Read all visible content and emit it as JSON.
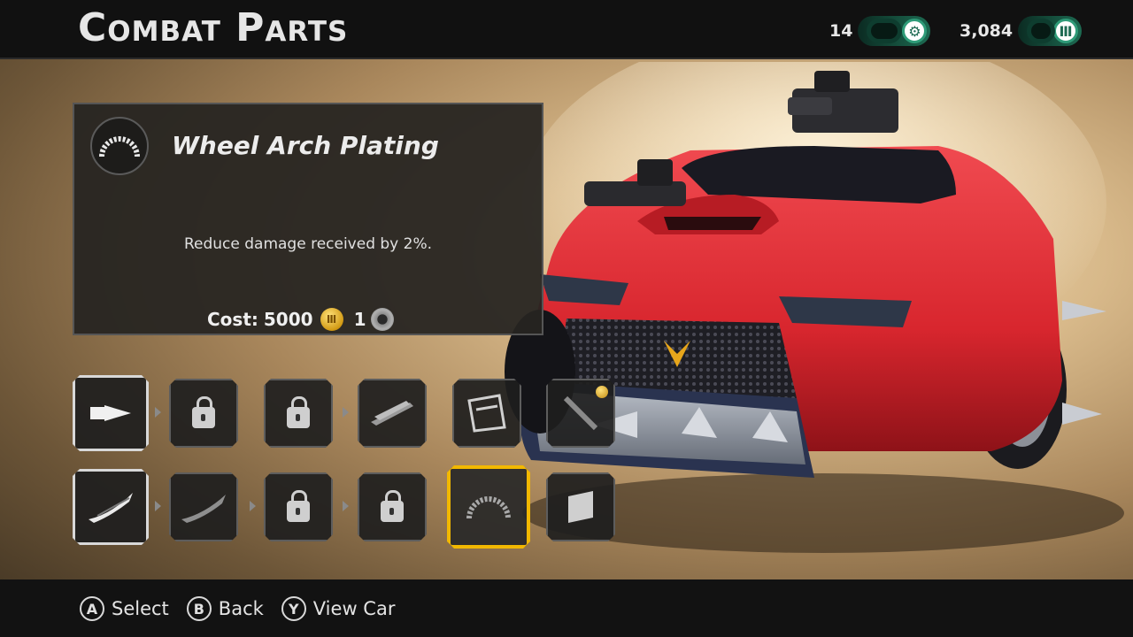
{
  "header": {
    "title": "Combat Parts",
    "gears_count": "14",
    "coins_count": "3,084"
  },
  "selected_part": {
    "name": "Wheel Arch Plating",
    "description": "Reduce damage received by 2%.",
    "cost_label": "Cost:",
    "cost_coins": "5000",
    "cost_gears": "1"
  },
  "parts": {
    "row1": [
      {
        "name": "drill-ram",
        "state": "owned"
      },
      {
        "name": "locked",
        "state": "locked"
      },
      {
        "name": "locked",
        "state": "locked"
      },
      {
        "name": "blade-plates",
        "state": "available"
      },
      {
        "name": "cage-frame",
        "state": "available"
      },
      {
        "name": "cannon-part",
        "state": "available"
      }
    ],
    "row2": [
      {
        "name": "wing-blades",
        "state": "owned"
      },
      {
        "name": "spiked-wing",
        "state": "available"
      },
      {
        "name": "locked",
        "state": "locked"
      },
      {
        "name": "locked",
        "state": "locked"
      },
      {
        "name": "wheel-arch-plating",
        "state": "selected"
      },
      {
        "name": "armor-plate",
        "state": "available"
      }
    ]
  },
  "footer": {
    "a_key": "A",
    "a_label": "Select",
    "b_key": "B",
    "b_label": "Back",
    "y_key": "Y",
    "y_label": "View Car"
  },
  "colors": {
    "selection": "#f2b800",
    "car_body": "#d8262e",
    "currency_green": "#1d6b52"
  }
}
